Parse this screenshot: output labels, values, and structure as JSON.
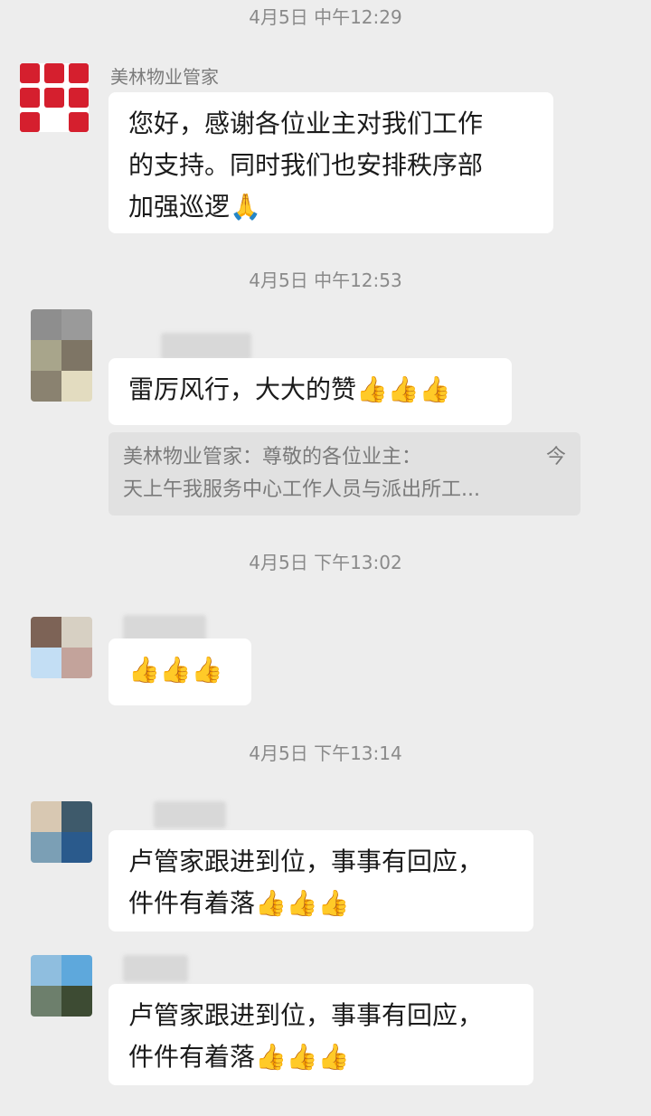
{
  "messages": [
    {
      "time": "4月5日 中午12:29",
      "sender": "美林物业管家",
      "lines": [
        "您好，感谢各位业主对我们工作",
        "的支持。同时我们也安排秩序部",
        "加强巡逻🙏"
      ]
    },
    {
      "time": "4月5日 中午12:53",
      "lines": [
        "雷厉风行，大大的赞👍👍👍"
      ],
      "quote": {
        "line1_left": "美林物业管家：尊敬的各位业主：",
        "line1_right": "今",
        "line2": "天上午我服务中心工作人员与派出所工..."
      }
    },
    {
      "time": "4月5日 下午13:02",
      "lines": [
        "👍👍👍"
      ]
    },
    {
      "time": "4月5日 下午13:14",
      "lines": [
        "卢管家跟进到位，事事有回应，",
        "件件有着落👍👍👍"
      ]
    },
    {
      "lines": [
        "卢管家跟进到位，事事有回应，",
        "件件有着落👍👍👍"
      ]
    }
  ],
  "colors": {
    "background": "#ededed",
    "bubble": "#ffffff",
    "quote": "#e1e1e1",
    "logo_red": "#d51f2e"
  }
}
